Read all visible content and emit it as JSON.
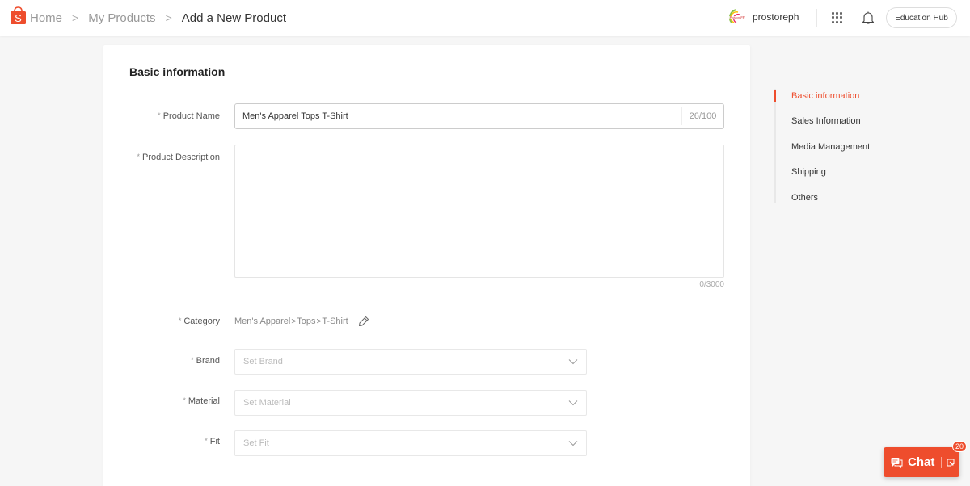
{
  "header": {
    "breadcrumbs": [
      {
        "label": "Home"
      },
      {
        "label": "My Products"
      },
      {
        "label": "Add a New Product"
      }
    ],
    "breadcrumb_separator": ">",
    "shop_name": "prostoreph",
    "education_hub_label": "Education Hub",
    "icons": {
      "logo": "shopee-bag-icon",
      "apps": "apps-grid-icon",
      "notifications": "bell-icon"
    }
  },
  "form": {
    "section_title": "Basic information",
    "required_marker": "*",
    "product_name": {
      "label": "Product Name",
      "value": "Men's Apparel Tops T-Shirt",
      "counter": "26/100"
    },
    "product_description": {
      "label": "Product Description",
      "value": "",
      "counter": "0/3000"
    },
    "category": {
      "label": "Category",
      "path": [
        "Men's Apparel",
        "Tops",
        "T-Shirt"
      ],
      "separator": ">"
    },
    "brand": {
      "label": "Brand",
      "placeholder": "Set Brand"
    },
    "material": {
      "label": "Material",
      "placeholder": "Set Material"
    },
    "fit": {
      "label": "Fit",
      "placeholder": "Set Fit"
    }
  },
  "sidenav": {
    "items": [
      {
        "label": "Basic information",
        "active": true
      },
      {
        "label": "Sales Information",
        "active": false
      },
      {
        "label": "Media Management",
        "active": false
      },
      {
        "label": "Shipping",
        "active": false
      },
      {
        "label": "Others",
        "active": false
      }
    ]
  },
  "chat": {
    "label": "Chat",
    "unread_count": "20"
  },
  "colors": {
    "brand": "#ee4d2d",
    "background": "#f6f6f6"
  }
}
